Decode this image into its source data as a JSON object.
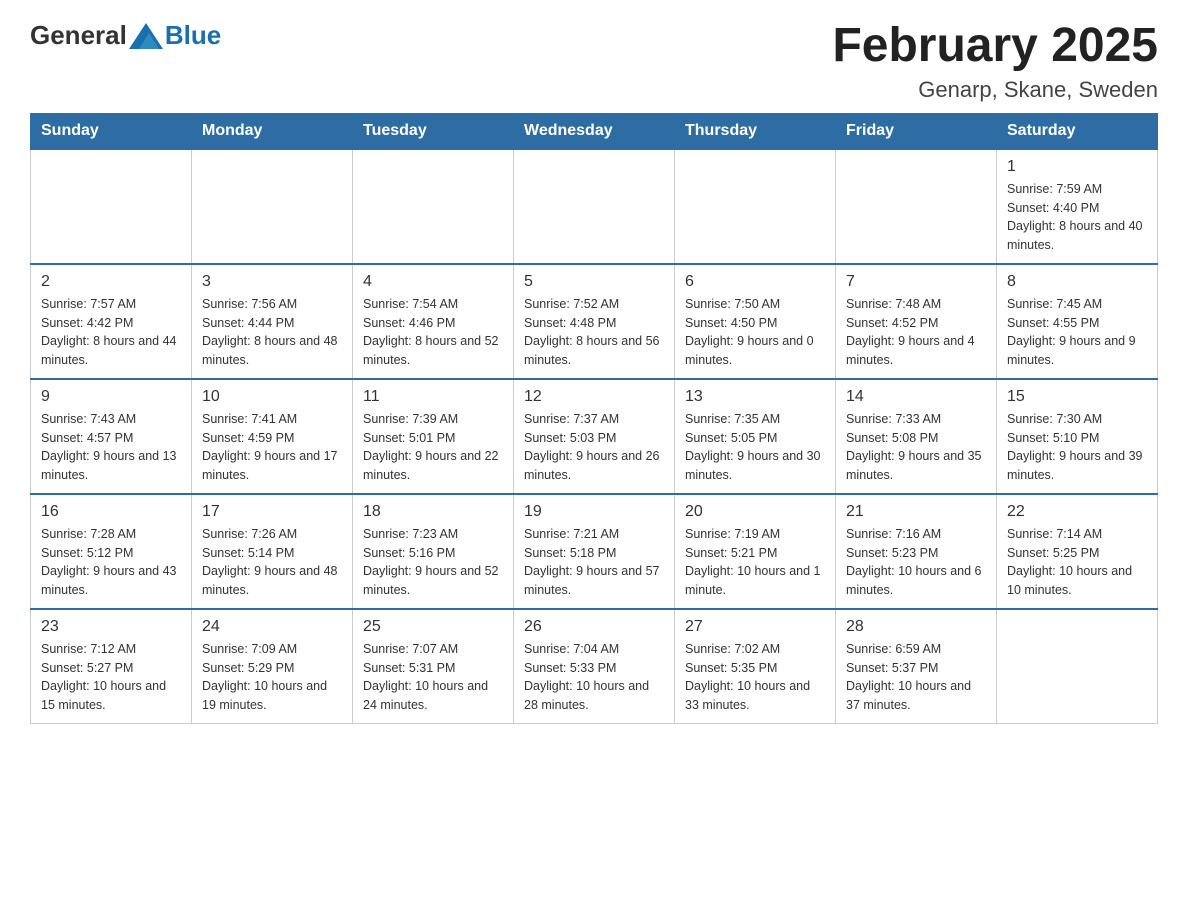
{
  "logo": {
    "general": "General",
    "blue": "Blue"
  },
  "title": "February 2025",
  "location": "Genarp, Skane, Sweden",
  "weekdays": [
    "Sunday",
    "Monday",
    "Tuesday",
    "Wednesday",
    "Thursday",
    "Friday",
    "Saturday"
  ],
  "weeks": [
    [
      {
        "day": "",
        "sunrise": "",
        "sunset": "",
        "daylight": ""
      },
      {
        "day": "",
        "sunrise": "",
        "sunset": "",
        "daylight": ""
      },
      {
        "day": "",
        "sunrise": "",
        "sunset": "",
        "daylight": ""
      },
      {
        "day": "",
        "sunrise": "",
        "sunset": "",
        "daylight": ""
      },
      {
        "day": "",
        "sunrise": "",
        "sunset": "",
        "daylight": ""
      },
      {
        "day": "",
        "sunrise": "",
        "sunset": "",
        "daylight": ""
      },
      {
        "day": "1",
        "sunrise": "Sunrise: 7:59 AM",
        "sunset": "Sunset: 4:40 PM",
        "daylight": "Daylight: 8 hours and 40 minutes."
      }
    ],
    [
      {
        "day": "2",
        "sunrise": "Sunrise: 7:57 AM",
        "sunset": "Sunset: 4:42 PM",
        "daylight": "Daylight: 8 hours and 44 minutes."
      },
      {
        "day": "3",
        "sunrise": "Sunrise: 7:56 AM",
        "sunset": "Sunset: 4:44 PM",
        "daylight": "Daylight: 8 hours and 48 minutes."
      },
      {
        "day": "4",
        "sunrise": "Sunrise: 7:54 AM",
        "sunset": "Sunset: 4:46 PM",
        "daylight": "Daylight: 8 hours and 52 minutes."
      },
      {
        "day": "5",
        "sunrise": "Sunrise: 7:52 AM",
        "sunset": "Sunset: 4:48 PM",
        "daylight": "Daylight: 8 hours and 56 minutes."
      },
      {
        "day": "6",
        "sunrise": "Sunrise: 7:50 AM",
        "sunset": "Sunset: 4:50 PM",
        "daylight": "Daylight: 9 hours and 0 minutes."
      },
      {
        "day": "7",
        "sunrise": "Sunrise: 7:48 AM",
        "sunset": "Sunset: 4:52 PM",
        "daylight": "Daylight: 9 hours and 4 minutes."
      },
      {
        "day": "8",
        "sunrise": "Sunrise: 7:45 AM",
        "sunset": "Sunset: 4:55 PM",
        "daylight": "Daylight: 9 hours and 9 minutes."
      }
    ],
    [
      {
        "day": "9",
        "sunrise": "Sunrise: 7:43 AM",
        "sunset": "Sunset: 4:57 PM",
        "daylight": "Daylight: 9 hours and 13 minutes."
      },
      {
        "day": "10",
        "sunrise": "Sunrise: 7:41 AM",
        "sunset": "Sunset: 4:59 PM",
        "daylight": "Daylight: 9 hours and 17 minutes."
      },
      {
        "day": "11",
        "sunrise": "Sunrise: 7:39 AM",
        "sunset": "Sunset: 5:01 PM",
        "daylight": "Daylight: 9 hours and 22 minutes."
      },
      {
        "day": "12",
        "sunrise": "Sunrise: 7:37 AM",
        "sunset": "Sunset: 5:03 PM",
        "daylight": "Daylight: 9 hours and 26 minutes."
      },
      {
        "day": "13",
        "sunrise": "Sunrise: 7:35 AM",
        "sunset": "Sunset: 5:05 PM",
        "daylight": "Daylight: 9 hours and 30 minutes."
      },
      {
        "day": "14",
        "sunrise": "Sunrise: 7:33 AM",
        "sunset": "Sunset: 5:08 PM",
        "daylight": "Daylight: 9 hours and 35 minutes."
      },
      {
        "day": "15",
        "sunrise": "Sunrise: 7:30 AM",
        "sunset": "Sunset: 5:10 PM",
        "daylight": "Daylight: 9 hours and 39 minutes."
      }
    ],
    [
      {
        "day": "16",
        "sunrise": "Sunrise: 7:28 AM",
        "sunset": "Sunset: 5:12 PM",
        "daylight": "Daylight: 9 hours and 43 minutes."
      },
      {
        "day": "17",
        "sunrise": "Sunrise: 7:26 AM",
        "sunset": "Sunset: 5:14 PM",
        "daylight": "Daylight: 9 hours and 48 minutes."
      },
      {
        "day": "18",
        "sunrise": "Sunrise: 7:23 AM",
        "sunset": "Sunset: 5:16 PM",
        "daylight": "Daylight: 9 hours and 52 minutes."
      },
      {
        "day": "19",
        "sunrise": "Sunrise: 7:21 AM",
        "sunset": "Sunset: 5:18 PM",
        "daylight": "Daylight: 9 hours and 57 minutes."
      },
      {
        "day": "20",
        "sunrise": "Sunrise: 7:19 AM",
        "sunset": "Sunset: 5:21 PM",
        "daylight": "Daylight: 10 hours and 1 minute."
      },
      {
        "day": "21",
        "sunrise": "Sunrise: 7:16 AM",
        "sunset": "Sunset: 5:23 PM",
        "daylight": "Daylight: 10 hours and 6 minutes."
      },
      {
        "day": "22",
        "sunrise": "Sunrise: 7:14 AM",
        "sunset": "Sunset: 5:25 PM",
        "daylight": "Daylight: 10 hours and 10 minutes."
      }
    ],
    [
      {
        "day": "23",
        "sunrise": "Sunrise: 7:12 AM",
        "sunset": "Sunset: 5:27 PM",
        "daylight": "Daylight: 10 hours and 15 minutes."
      },
      {
        "day": "24",
        "sunrise": "Sunrise: 7:09 AM",
        "sunset": "Sunset: 5:29 PM",
        "daylight": "Daylight: 10 hours and 19 minutes."
      },
      {
        "day": "25",
        "sunrise": "Sunrise: 7:07 AM",
        "sunset": "Sunset: 5:31 PM",
        "daylight": "Daylight: 10 hours and 24 minutes."
      },
      {
        "day": "26",
        "sunrise": "Sunrise: 7:04 AM",
        "sunset": "Sunset: 5:33 PM",
        "daylight": "Daylight: 10 hours and 28 minutes."
      },
      {
        "day": "27",
        "sunrise": "Sunrise: 7:02 AM",
        "sunset": "Sunset: 5:35 PM",
        "daylight": "Daylight: 10 hours and 33 minutes."
      },
      {
        "day": "28",
        "sunrise": "Sunrise: 6:59 AM",
        "sunset": "Sunset: 5:37 PM",
        "daylight": "Daylight: 10 hours and 37 minutes."
      },
      {
        "day": "",
        "sunrise": "",
        "sunset": "",
        "daylight": ""
      }
    ]
  ]
}
